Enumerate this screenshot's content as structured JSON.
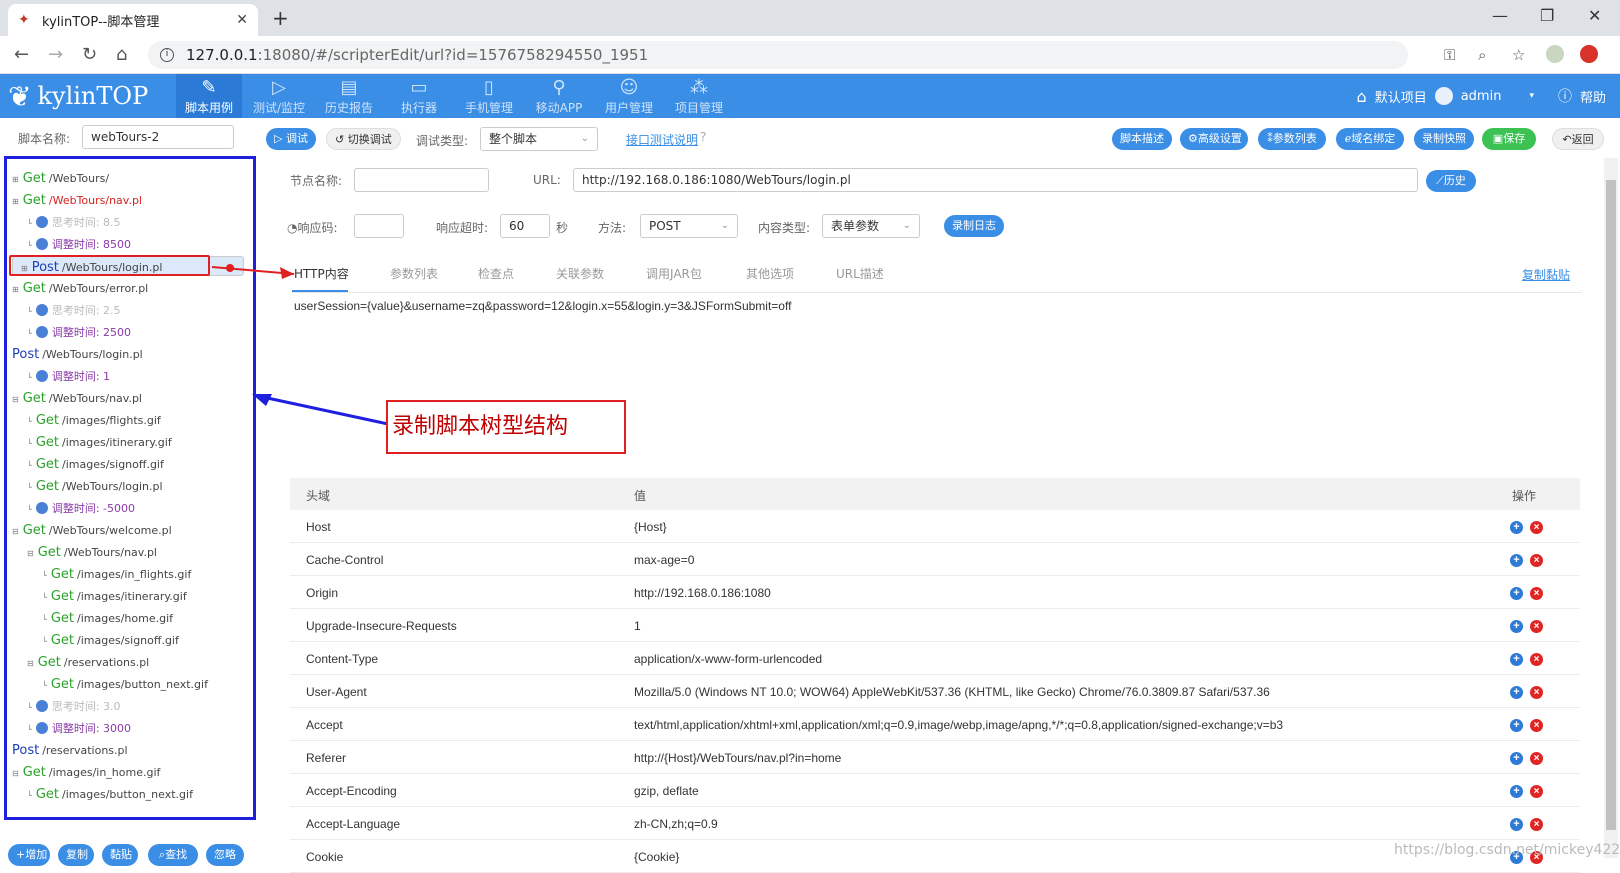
{
  "browser": {
    "tab_title": "kylinTOP--脚本管理",
    "url_host": "127.0.0.1",
    "url_rest": ":18080/#/scripterEdit/url?id=1576758294550_1951"
  },
  "header": {
    "logo": "kylinTOP",
    "nav": [
      "脚本用例",
      "测试/监控",
      "历史报告",
      "执行器",
      "手机管理",
      "移动APP",
      "用户管理",
      "项目管理"
    ],
    "project": "默认项目",
    "user": "admin",
    "help": "帮助"
  },
  "toolbar": {
    "script_name_label": "脚本名称:",
    "script_name": "webTours-2",
    "debug": "调试",
    "switch_debug": "切换调试",
    "debug_type_label": "调试类型:",
    "debug_type": "整个脚本",
    "api_doc": "接口测试说明",
    "right_buttons": [
      "脚本描述",
      "高级设置",
      "参数列表",
      "域名绑定",
      "录制快照",
      "保存",
      "返回"
    ]
  },
  "tree": {
    "nodes": [
      {
        "m": "Get",
        "p": "/WebTours/",
        "red": false,
        "level": 0,
        "tg": "⊞"
      },
      {
        "m": "Get",
        "p": "/WebTours/nav.pl",
        "red": true,
        "level": 0,
        "tg": "⊞"
      },
      {
        "think": "思考时间: 8.5",
        "level": 1
      },
      {
        "adj": "调整时间: 8500",
        "level": 1
      },
      {
        "m": "Post",
        "p": "/WebTours/login.pl",
        "red": false,
        "level": 0,
        "tg": "⊞",
        "selected": true
      },
      {
        "m": "Get",
        "p": "/WebTours/error.pl",
        "red": false,
        "level": 0,
        "tg": "⊞"
      },
      {
        "think": "思考时间: 2.5",
        "level": 1
      },
      {
        "adj": "调整时间: 2500",
        "level": 1
      },
      {
        "m": "Post",
        "p": "/WebTours/login.pl",
        "red": false,
        "level": 0
      },
      {
        "adj": "调整时间: 1",
        "level": 1
      },
      {
        "m": "Get",
        "p": "/WebTours/nav.pl",
        "red": false,
        "level": 0,
        "tg": "⊟"
      },
      {
        "m": "Get",
        "p": "/images/flights.gif",
        "red": false,
        "level": 1
      },
      {
        "m": "Get",
        "p": "/images/itinerary.gif",
        "red": false,
        "level": 1
      },
      {
        "m": "Get",
        "p": "/images/signoff.gif",
        "red": false,
        "level": 1
      },
      {
        "m": "Get",
        "p": "/WebTours/login.pl",
        "red": false,
        "level": 1
      },
      {
        "adj": "调整时间: -5000",
        "level": 1
      },
      {
        "m": "Get",
        "p": "/WebTours/welcome.pl",
        "red": false,
        "level": 0,
        "tg": "⊟"
      },
      {
        "m": "Get",
        "p": "/WebTours/nav.pl",
        "red": false,
        "level": 1,
        "tg": "⊟"
      },
      {
        "m": "Get",
        "p": "/images/in_flights.gif",
        "red": false,
        "level": 2
      },
      {
        "m": "Get",
        "p": "/images/itinerary.gif",
        "red": false,
        "level": 2
      },
      {
        "m": "Get",
        "p": "/images/home.gif",
        "red": false,
        "level": 2
      },
      {
        "m": "Get",
        "p": "/images/signoff.gif",
        "red": false,
        "level": 2
      },
      {
        "m": "Get",
        "p": "/reservations.pl",
        "red": false,
        "level": 1,
        "tg": "⊟"
      },
      {
        "m": "Get",
        "p": "/images/button_next.gif",
        "red": false,
        "level": 2
      },
      {
        "think": "思考时间: 3.0",
        "level": 1
      },
      {
        "adj": "调整时间: 3000",
        "level": 1
      },
      {
        "m": "Post",
        "p": "/reservations.pl",
        "red": false,
        "level": 0
      },
      {
        "m": "Get",
        "p": "/images/in_home.gif",
        "red": false,
        "level": 0,
        "tg": "⊟"
      },
      {
        "m": "Get",
        "p": "/images/button_next.gif",
        "red": false,
        "level": 1
      }
    ],
    "bottom_buttons": [
      "增加",
      "复制",
      "黏贴",
      "查找",
      "忽略"
    ],
    "annotation": "录制脚本树型结构"
  },
  "form": {
    "node_name_label": "节点名称:",
    "url_label": "URL:",
    "url": "http://192.168.0.186:1080/WebTours/login.pl",
    "history": "历史",
    "resp_code_label": "响应码:",
    "timeout_label": "响应超时:",
    "timeout": "60",
    "sec": "秒",
    "method_label": "方法:",
    "method": "POST",
    "content_type_label": "内容类型:",
    "content_type": "表单参数",
    "record_log": "录制日志",
    "tabs": [
      "HTTP内容",
      "参数列表",
      "检查点",
      "关联参数",
      "调用JAR包",
      "其他选项",
      "URL描述"
    ],
    "copy_paste": "复制黏贴",
    "body": "userSession={value}&username=zq&password=12&login.x=55&login.y=3&JSFormSubmit=off"
  },
  "headers_table": {
    "col_key": "头域",
    "col_val": "值",
    "col_ops": "操作",
    "rows": [
      {
        "k": "Host",
        "v": "{Host}"
      },
      {
        "k": "Cache-Control",
        "v": "max-age=0"
      },
      {
        "k": "Origin",
        "v": "http://192.168.0.186:1080"
      },
      {
        "k": "Upgrade-Insecure-Requests",
        "v": "1"
      },
      {
        "k": "Content-Type",
        "v": "application/x-www-form-urlencoded"
      },
      {
        "k": "User-Agent",
        "v": "Mozilla/5.0 (Windows NT 10.0; WOW64) AppleWebKit/537.36 (KHTML, like Gecko) Chrome/76.0.3809.87 Safari/537.36"
      },
      {
        "k": "Accept",
        "v": "text/html,application/xhtml+xml,application/xml;q=0.9,image/webp,image/apng,*/*;q=0.8,application/signed-exchange;v=b3"
      },
      {
        "k": "Referer",
        "v": "http://{Host}/WebTours/nav.pl?in=home"
      },
      {
        "k": "Accept-Encoding",
        "v": "gzip, deflate"
      },
      {
        "k": "Accept-Language",
        "v": "zh-CN,zh;q=0.9"
      },
      {
        "k": "Cookie",
        "v": "{Cookie}"
      }
    ]
  },
  "watermark": "https://blog.csdn.net/mickey422"
}
